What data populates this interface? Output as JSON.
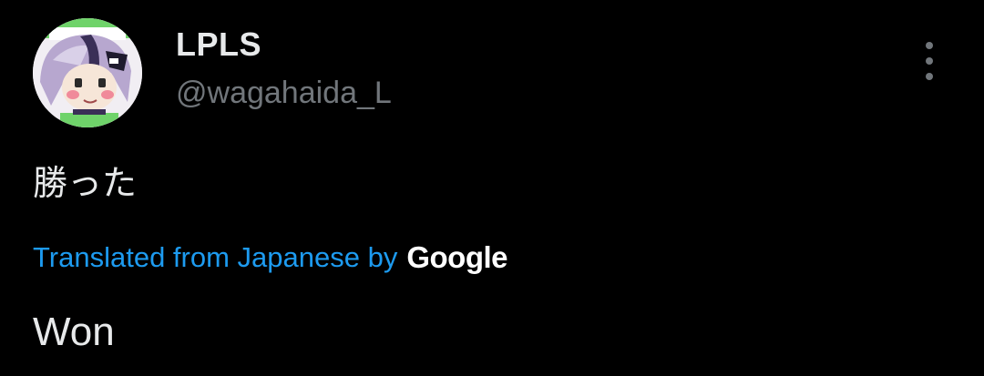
{
  "tweet": {
    "author": {
      "display_name": "LPLS",
      "handle": "@wagahaida_L",
      "avatar_icon": "avatar-anime-character-icon"
    },
    "more_icon": "more-vertical-icon",
    "text": "勝った",
    "translation": {
      "label": "Translated from Japanese by",
      "provider": "Google",
      "text": "Won"
    }
  },
  "colors": {
    "background": "#000000",
    "primary_text": "#e7e9ea",
    "secondary_text": "#71767b",
    "link": "#1d9bf0"
  }
}
